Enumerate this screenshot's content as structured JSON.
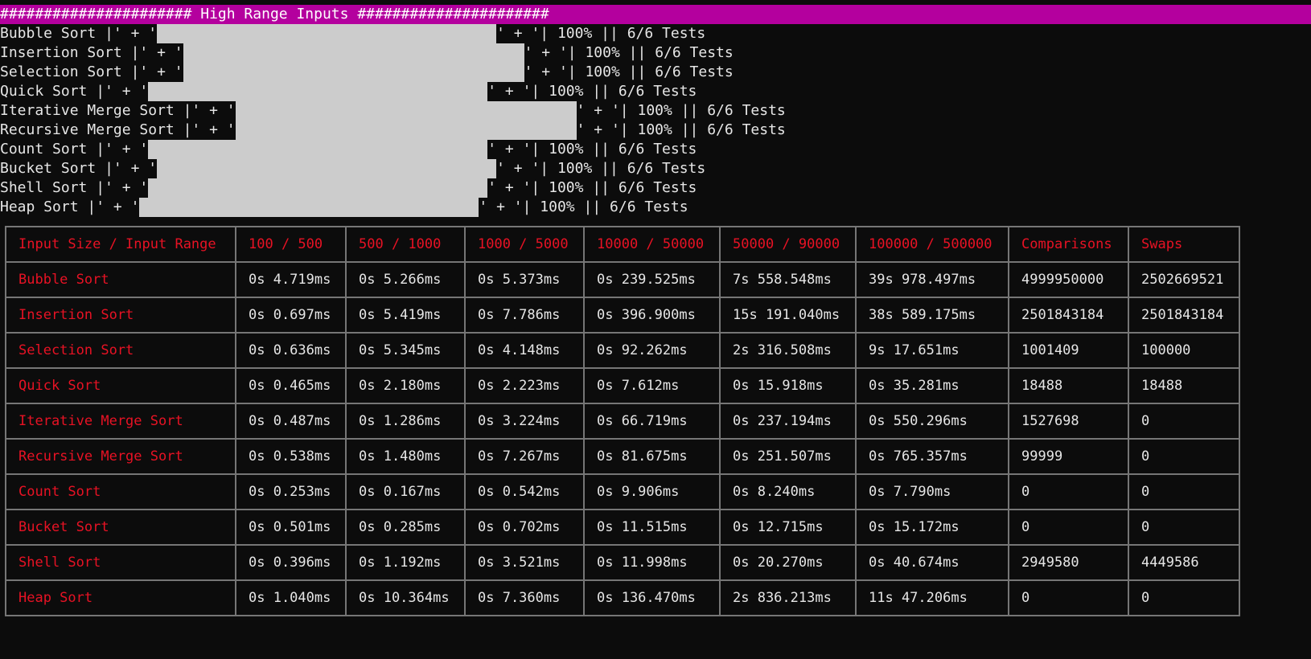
{
  "banner": "###################### High Range Inputs ######################",
  "progress": {
    "open_seg": "|' + '",
    "close_seg": "' + '|",
    "percent_label": "100%",
    "tests_label": "6/6 Tests",
    "rows": [
      {
        "name": "Bubble Sort",
        "progress": 1.0
      },
      {
        "name": "Insertion Sort",
        "progress": 1.0
      },
      {
        "name": "Selection Sort",
        "progress": 1.0
      },
      {
        "name": "Quick Sort",
        "progress": 1.0
      },
      {
        "name": "Iterative Merge Sort",
        "progress": 1.0
      },
      {
        "name": "Recursive Merge Sort",
        "progress": 1.0
      },
      {
        "name": "Count Sort",
        "progress": 1.0
      },
      {
        "name": "Bucket Sort",
        "progress": 1.0
      },
      {
        "name": "Shell Sort",
        "progress": 1.0
      },
      {
        "name": "Heap Sort",
        "progress": 1.0
      }
    ]
  },
  "table": {
    "headers": [
      "Input Size / Input Range",
      "100 / 500",
      "500 / 1000",
      "1000 / 5000",
      "10000 / 50000",
      "50000 / 90000",
      "100000 / 500000",
      "Comparisons",
      "Swaps"
    ],
    "rows": [
      {
        "name": "Bubble Sort",
        "cells": [
          "0s 4.719ms",
          "0s 5.266ms",
          "0s 5.373ms",
          "0s 239.525ms",
          "7s 558.548ms",
          "39s 978.497ms",
          "4999950000",
          "2502669521"
        ]
      },
      {
        "name": "Insertion Sort",
        "cells": [
          "0s 0.697ms",
          "0s 5.419ms",
          "0s 7.786ms",
          "0s 396.900ms",
          "15s 191.040ms",
          "38s 589.175ms",
          "2501843184",
          "2501843184"
        ]
      },
      {
        "name": "Selection Sort",
        "cells": [
          "0s 0.636ms",
          "0s 5.345ms",
          "0s 4.148ms",
          "0s 92.262ms",
          "2s 316.508ms",
          "9s 17.651ms",
          "1001409",
          "100000"
        ]
      },
      {
        "name": "Quick Sort",
        "cells": [
          "0s 0.465ms",
          "0s 2.180ms",
          "0s 2.223ms",
          "0s 7.612ms",
          "0s 15.918ms",
          "0s 35.281ms",
          "18488",
          "18488"
        ]
      },
      {
        "name": "Iterative Merge Sort",
        "cells": [
          "0s 0.487ms",
          "0s 1.286ms",
          "0s 3.224ms",
          "0s 66.719ms",
          "0s 237.194ms",
          "0s 550.296ms",
          "1527698",
          "0"
        ]
      },
      {
        "name": "Recursive Merge Sort",
        "cells": [
          "0s 0.538ms",
          "0s 1.480ms",
          "0s 7.267ms",
          "0s 81.675ms",
          "0s 251.507ms",
          "0s 765.357ms",
          "99999",
          "0"
        ]
      },
      {
        "name": "Count Sort",
        "cells": [
          "0s 0.253ms",
          "0s 0.167ms",
          "0s 0.542ms",
          "0s 9.906ms",
          "0s 8.240ms",
          "0s 7.790ms",
          "0",
          "0"
        ]
      },
      {
        "name": "Bucket Sort",
        "cells": [
          "0s 0.501ms",
          "0s 0.285ms",
          "0s 0.702ms",
          "0s 11.515ms",
          "0s 12.715ms",
          "0s 15.172ms",
          "0",
          "0"
        ]
      },
      {
        "name": "Shell Sort",
        "cells": [
          "0s 0.396ms",
          "0s 1.192ms",
          "0s 3.521ms",
          "0s 11.998ms",
          "0s 20.270ms",
          "0s 40.674ms",
          "2949580",
          "4449586"
        ]
      },
      {
        "name": "Heap Sort",
        "cells": [
          "0s 1.040ms",
          "0s 10.364ms",
          "0s 7.360ms",
          "0s 136.470ms",
          "2s 836.213ms",
          "11s 47.206ms",
          "0",
          "0"
        ]
      }
    ]
  },
  "colors": {
    "banner_bg": "#b4009e",
    "terminal_bg": "#0c0c0c",
    "bar_fill": "#cccccc",
    "header_text": "#e81224",
    "cell_text": "#e6e6e6",
    "grid_line": "#767676"
  }
}
